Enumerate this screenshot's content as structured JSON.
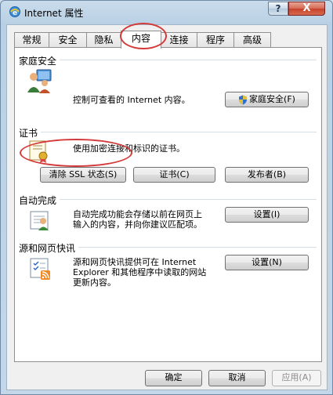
{
  "window": {
    "title": "Internet 属性",
    "help_glyph": "?",
    "close_glyph": "X"
  },
  "tabs": [
    {
      "label": "常规",
      "active": false
    },
    {
      "label": "安全",
      "active": false
    },
    {
      "label": "隐私",
      "active": false
    },
    {
      "label": "内容",
      "active": true
    },
    {
      "label": "连接",
      "active": false
    },
    {
      "label": "程序",
      "active": false
    },
    {
      "label": "高级",
      "active": false
    }
  ],
  "family_safety": {
    "heading": "家庭安全",
    "description": "控制可查看的 Internet 内容。",
    "button": "家庭安全(F)"
  },
  "certificates": {
    "heading": "证书",
    "description": "使用加密连接和标识的证书。",
    "clear_ssl_button": "清除 SSL 状态(S)",
    "certificates_button": "证书(C)",
    "publishers_button": "发布者(B)"
  },
  "autocomplete": {
    "heading": "自动完成",
    "description_line1": "自动完成功能会存储以前在网页上",
    "description_line2": "输入的内容，并向你建议匹配项。",
    "settings_button": "设置(I)"
  },
  "feeds": {
    "heading": "源和网页快讯",
    "description_line1": "源和网页快讯提供可在 Internet",
    "description_line2": "Explorer 和其他程序中读取的网站",
    "description_line3": "更新内容。",
    "settings_button": "设置(N)"
  },
  "footer": {
    "ok": "确定",
    "cancel": "取消",
    "apply": "应用(A)",
    "apply_enabled": false
  },
  "colors": {
    "annotation_ring": "#d43a3a",
    "title_bar": "#c9dceb",
    "close_button": "#c4412b"
  }
}
